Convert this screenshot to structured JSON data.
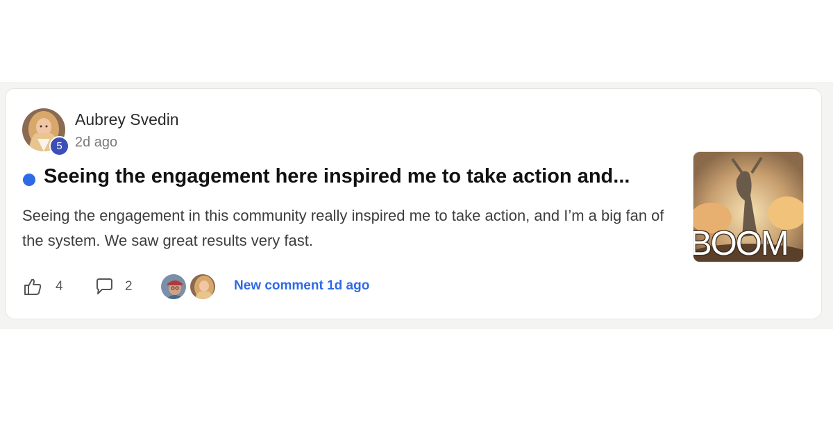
{
  "post": {
    "author": {
      "name": "Aubrey Svedin",
      "level": "5",
      "avatar_icon": "author-avatar"
    },
    "time": "2d ago",
    "title": "Seeing the engagement here inspired me to take action and...",
    "body": "Seeing the engagement in this community really inspired me to take action, and I’m a big fan of the system. We saw great results very fast.",
    "unread": true,
    "thumbnail": {
      "text": "BOOM"
    },
    "likes": "4",
    "comments": "2",
    "last_activity": "New comment 1d ago"
  },
  "colors": {
    "accent": "#2f6ae6",
    "level_badge": "#3c4fb7",
    "background_band": "#f4f4f2"
  }
}
